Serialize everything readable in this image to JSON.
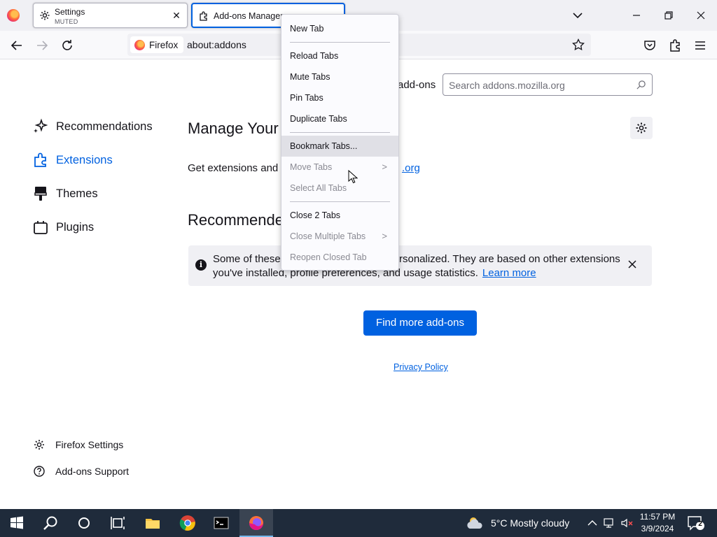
{
  "browser": {
    "tabs": [
      {
        "title": "Settings",
        "subtitle": "MUTED",
        "icon": "gear-icon"
      },
      {
        "title": "Add-ons Manager",
        "icon": "puzzle-icon"
      }
    ],
    "identity_label": "Firefox",
    "url": "about:addons"
  },
  "sidebar": {
    "items": [
      {
        "label": "Recommendations",
        "icon": "sparkle-icon"
      },
      {
        "label": "Extensions",
        "icon": "puzzle-icon"
      },
      {
        "label": "Themes",
        "icon": "brush-icon"
      },
      {
        "label": "Plugins",
        "icon": "plugin-icon"
      }
    ],
    "footer": [
      {
        "label": "Firefox Settings",
        "icon": "gear-icon"
      },
      {
        "label": "Add-ons Support",
        "icon": "help-icon"
      }
    ]
  },
  "main": {
    "addons_label": "add-ons",
    "search_placeholder": "Search addons.mozilla.org",
    "manage_title": "Manage Your E",
    "get_extensions_text": "Get extensions and t",
    "amo_link_tail": ".org",
    "recommended_title": "Recommended",
    "notice": {
      "text_a": "Some of these",
      "text_b": "rsonalized. They are based on other extensions",
      "text_c": "you've installed, profile preferences, and usage statistics.",
      "learn_more": "Learn more"
    },
    "find_more_button": "Find more add-ons",
    "privacy_policy": "Privacy Policy"
  },
  "context_menu": {
    "items": [
      {
        "label": "New Tab",
        "disabled": false
      },
      {
        "label": "Reload Tabs",
        "disabled": false
      },
      {
        "label": "Mute Tabs",
        "disabled": false
      },
      {
        "label": "Pin Tabs",
        "disabled": false
      },
      {
        "label": "Duplicate Tabs",
        "disabled": false
      },
      {
        "label": "Bookmark Tabs...",
        "disabled": false,
        "hovered": true
      },
      {
        "label": "Move Tabs",
        "disabled": true,
        "submenu": true
      },
      {
        "label": "Select All Tabs",
        "disabled": true
      },
      {
        "label": "Close 2 Tabs",
        "disabled": false
      },
      {
        "label": "Close Multiple Tabs",
        "disabled": true,
        "submenu": true
      },
      {
        "label": "Reopen Closed Tab",
        "disabled": true
      }
    ]
  },
  "taskbar": {
    "weather": "5°C  Mostly cloudy",
    "time": "11:57 PM",
    "date": "3/9/2024",
    "notification_count": "2"
  },
  "colors": {
    "accent": "#0061e0",
    "taskbar": "#1f2b3b"
  }
}
